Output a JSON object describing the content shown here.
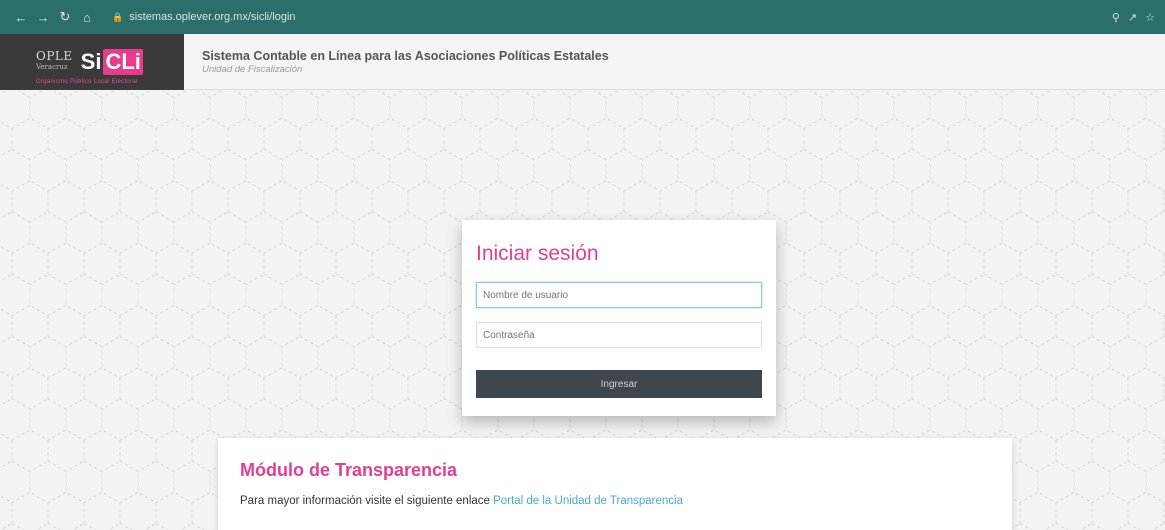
{
  "browser": {
    "url": "sistemas.oplever.org.mx/sicli/login"
  },
  "header": {
    "ople_logo": "OPLE",
    "ople_sub": "Veracruz",
    "brand_a": "Si",
    "brand_b": "CLi",
    "tagline": "Organismo Público Local Electoral",
    "title": "Sistema Contable en Línea para las Asociaciones Políticas Estatales",
    "subtitle": "Unidad de Fiscalización"
  },
  "login": {
    "title": "Iniciar sesión",
    "username_placeholder": "Nombre de usuario",
    "password_placeholder": "Contraseña",
    "submit_label": "Ingresar"
  },
  "transparency": {
    "title": "Módulo de Transparencia",
    "text": "Para mayor información visite el siguiente enlace",
    "link_label": "Portal de la Unidad de Transparencia"
  },
  "colors": {
    "accent": "#e0408f",
    "link": "#4aa8d8",
    "button": "#3f464d",
    "browser_bar": "#2c6e6a"
  }
}
